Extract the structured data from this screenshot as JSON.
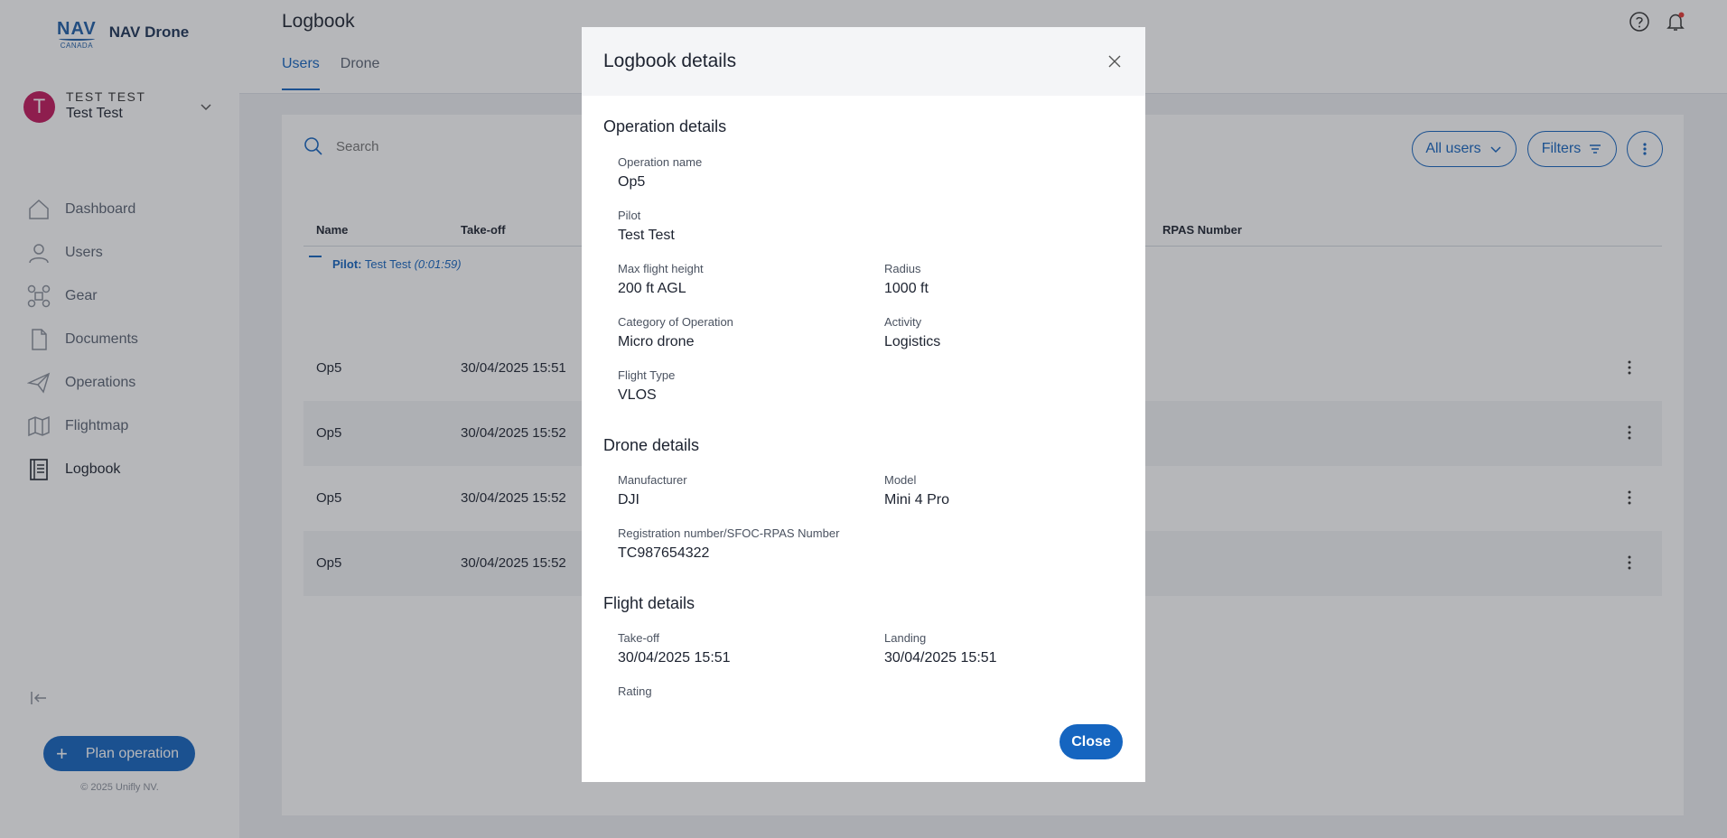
{
  "app": {
    "logo_mark": "NAV",
    "logo_sub": "CANADA",
    "name": "NAV Drone",
    "copyright": "© 2025 Unifly NV."
  },
  "user": {
    "initial": "T",
    "org": "TEST TEST",
    "name": "Test Test"
  },
  "sidebar": {
    "items": [
      {
        "label": "Dashboard"
      },
      {
        "label": "Users"
      },
      {
        "label": "Gear"
      },
      {
        "label": "Documents"
      },
      {
        "label": "Operations"
      },
      {
        "label": "Flightmap"
      },
      {
        "label": "Logbook"
      }
    ],
    "plan_button": "Plan operation"
  },
  "header": {
    "title": "Logbook",
    "tabs": [
      {
        "label": "Users"
      },
      {
        "label": "Drone"
      }
    ]
  },
  "toolbar": {
    "search_placeholder": "Search",
    "all_users": "All users",
    "filters": "Filters"
  },
  "table": {
    "columns": {
      "name": "Name",
      "takeoff": "Take-off",
      "rpas": "RPAS Number"
    },
    "group": {
      "prefix": "Pilot:",
      "name": "Test Test",
      "duration": "(0:01:59)"
    },
    "rows": [
      {
        "name": "Op5",
        "takeoff": "30/04/2025 15:51"
      },
      {
        "name": "Op5",
        "takeoff": "30/04/2025 15:52"
      },
      {
        "name": "Op5",
        "takeoff": "30/04/2025 15:52"
      },
      {
        "name": "Op5",
        "takeoff": "30/04/2025 15:52"
      }
    ]
  },
  "modal": {
    "title": "Logbook details",
    "operation": {
      "section": "Operation details",
      "op_name_label": "Operation name",
      "op_name": "Op5",
      "pilot_label": "Pilot",
      "pilot": "Test Test",
      "height_label": "Max flight height",
      "height": "200 ft AGL",
      "radius_label": "Radius",
      "radius": "1000 ft",
      "category_label": "Category of Operation",
      "category": "Micro drone",
      "activity_label": "Activity",
      "activity": "Logistics",
      "flight_type_label": "Flight Type",
      "flight_type": "VLOS"
    },
    "drone": {
      "section": "Drone details",
      "manufacturer_label": "Manufacturer",
      "manufacturer": "DJI",
      "model_label": "Model",
      "model": "Mini 4 Pro",
      "reg_label": "Registration number/SFOC-RPAS Number",
      "reg": "TC987654322"
    },
    "flight": {
      "section": "Flight details",
      "takeoff_label": "Take-off",
      "takeoff": "30/04/2025 15:51",
      "landing_label": "Landing",
      "landing": "30/04/2025 15:51",
      "rating_label": "Rating"
    },
    "close_button": "Close"
  },
  "colors": {
    "primary": "#1565c0",
    "avatar": "#c2185b",
    "notification_dot": "#e53935"
  }
}
